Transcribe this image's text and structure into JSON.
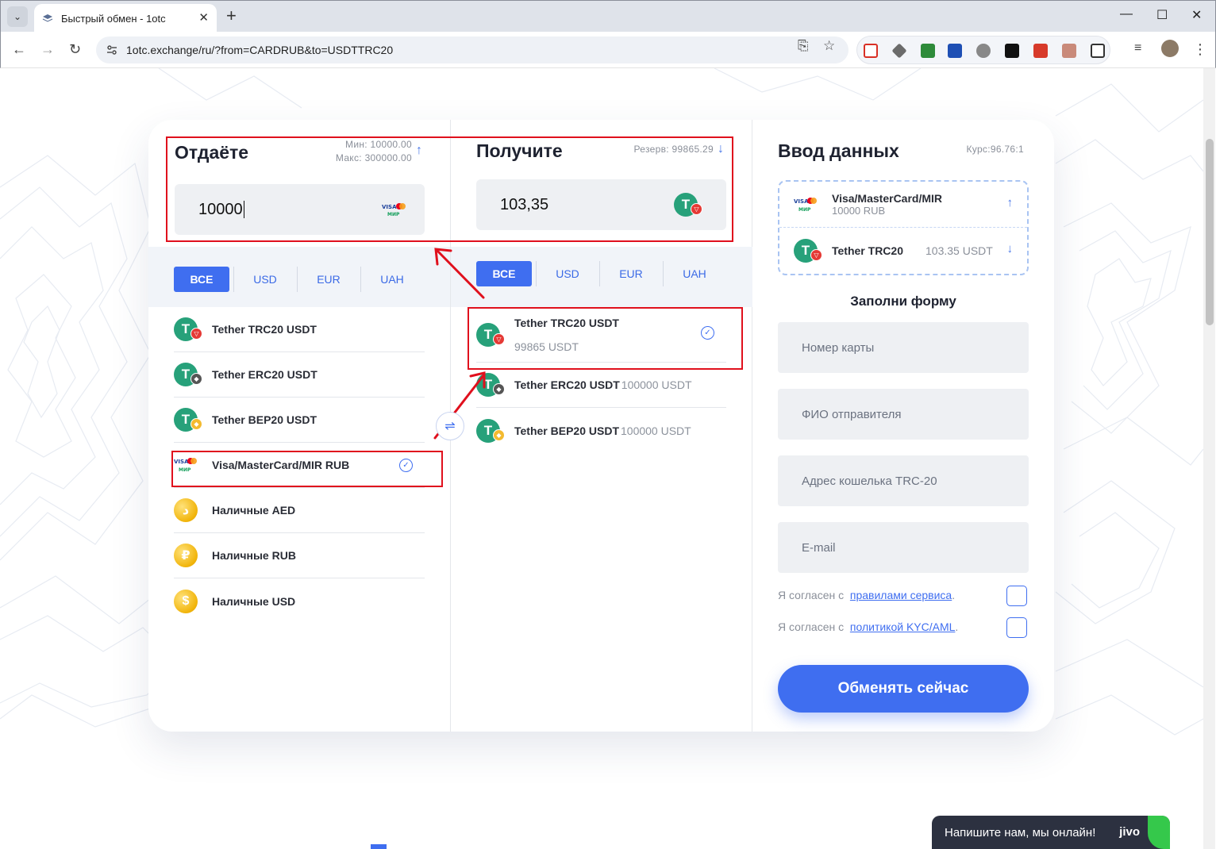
{
  "browser": {
    "tab_title": "Быстрый обмен - 1otc",
    "url": "1otc.exchange/ru/?from=CARDRUB&to=USDTTRC20"
  },
  "give": {
    "title": "Отдаёте",
    "min_label": "Мин: 10000.00",
    "max_label": "Макс: 300000.00",
    "amount": "10000",
    "filters": [
      "ВСЕ",
      "USD",
      "EUR",
      "UAH"
    ],
    "active_filter": "ВСЕ",
    "currencies": [
      {
        "name": "Tether TRC20 USDT",
        "icon": "tether-trc20-icon"
      },
      {
        "name": "Tether ERC20 USDT",
        "icon": "tether-erc20-icon"
      },
      {
        "name": "Tether BEP20 USDT",
        "icon": "tether-bep20-icon"
      },
      {
        "name": "Visa/MasterCard/MIR RUB",
        "icon": "visa-mastercard-mir-icon",
        "selected": true
      },
      {
        "name": "Наличные AED",
        "icon": "cash-aed-icon"
      },
      {
        "name": "Наличные RUB",
        "icon": "cash-rub-icon"
      },
      {
        "name": "Наличные USD",
        "icon": "cash-usd-icon"
      }
    ]
  },
  "receive": {
    "title": "Получите",
    "reserve_label": "Резерв: 99865.29",
    "amount": "103,35",
    "filters": [
      "ВСЕ",
      "USD",
      "EUR",
      "UAH"
    ],
    "active_filter": "ВСЕ",
    "currencies": [
      {
        "name": "Tether TRC20 USDT",
        "reserve": "99865 USDT",
        "icon": "tether-trc20-icon",
        "selected": true
      },
      {
        "name": "Tether ERC20 USDT",
        "reserve": "100000 USDT",
        "icon": "tether-erc20-icon"
      },
      {
        "name": "Tether BEP20 USDT",
        "reserve": "100000 USDT",
        "icon": "tether-bep20-icon"
      }
    ]
  },
  "form": {
    "title": "Ввод данных",
    "rate": "Курс:96.76:1",
    "summary": {
      "from_name": "Visa/MasterCard/MIR",
      "from_amount": "10000 RUB",
      "to_name": "Tether TRC20",
      "to_amount": "103.35 USDT"
    },
    "subtitle": "Заполни форму",
    "fields": [
      "Номер карты",
      "ФИО отправителя",
      "Адрес кошелька TRC-20",
      "E-mail"
    ],
    "agree_prefix": "Я согласен с",
    "agree_rules_link": "правилами сервиса",
    "agree_kyc_link": "политикой KYC/AML",
    "submit": "Обменять сейчас"
  },
  "chat": {
    "text": "Напишите нам, мы онлайн!",
    "brand": "jivo"
  },
  "colors": {
    "accent": "#3f6ef0",
    "tether": "#27a17a",
    "annotation": "#e0101d"
  }
}
